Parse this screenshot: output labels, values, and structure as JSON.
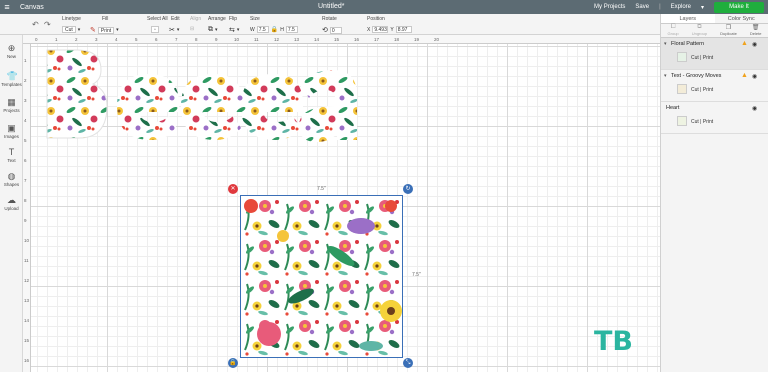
{
  "topbar": {
    "menu_icon": "hamburger-icon",
    "app_name": "Canvas",
    "doc_title": "Untitled*",
    "my_projects": "My Projects",
    "save": "Save",
    "explore": "Explore",
    "make_it": "Make It"
  },
  "toolbar": {
    "undo_icon": "undo-icon",
    "redo_icon": "redo-icon",
    "linetype_label": "Linetype",
    "linetype_value": "Cut",
    "fill_label": "Fill",
    "fill_value": "Print",
    "select_all_label": "Select All",
    "edit_label": "Edit",
    "align_label": "Align",
    "arrange_label": "Arrange",
    "flip_label": "Flip",
    "size_label": "Size",
    "w_label": "W",
    "w_value": "7.5",
    "h_label": "H",
    "h_value": "7.5",
    "rotate_label": "Rotate",
    "rotate_value": "0",
    "position_label": "Position",
    "x_label": "X",
    "x_value": "9.493",
    "y_label": "Y",
    "y_value": "8.97"
  },
  "sidebar": {
    "items": [
      {
        "label": "New",
        "icon": "plus-circle-icon"
      },
      {
        "label": "Templates",
        "icon": "shirt-icon"
      },
      {
        "label": "Projects",
        "icon": "grid-icon"
      },
      {
        "label": "Images",
        "icon": "image-icon"
      },
      {
        "label": "Text",
        "icon": "text-icon"
      },
      {
        "label": "Shapes",
        "icon": "shapes-icon"
      },
      {
        "label": "Upload",
        "icon": "cloud-upload-icon"
      }
    ]
  },
  "ruler": {
    "top": [
      "0",
      "1",
      "2",
      "3",
      "4",
      "5",
      "6",
      "7",
      "8",
      "9",
      "10",
      "11",
      "12",
      "13",
      "14",
      "15",
      "16",
      "17",
      "18",
      "19",
      "20"
    ],
    "left": [
      "1",
      "2",
      "3",
      "4",
      "5",
      "6",
      "7",
      "8",
      "9",
      "10",
      "11",
      "12",
      "13",
      "14",
      "15",
      "16",
      "17",
      "18",
      "19",
      "20"
    ]
  },
  "canvas": {
    "pattern_width_label": "7.5\"",
    "pattern_height_label": "7.5\"",
    "delete_icon": "close-icon",
    "rotate_icon": "rotate-icon",
    "lock_icon": "lock-icon",
    "resize_icon": "resize-icon"
  },
  "panel": {
    "tabs": [
      "Layers",
      "Color Sync"
    ],
    "tools": [
      "Group",
      "Ungroup",
      "Duplicate",
      "Delete"
    ],
    "layers": [
      {
        "name": "Floral Pattern",
        "op": "Cut | Print",
        "warning": true
      },
      {
        "name": "Text - Groovy Moves",
        "op": "Cut | Print",
        "warning": true
      },
      {
        "name": "Heart",
        "op": "Cut | Print",
        "warning": false
      }
    ]
  },
  "watermark": "TB",
  "colors": {
    "topbar": "#5c6b73",
    "make_it": "#1fae3d",
    "accent_blue": "#3a6fb7",
    "delete_red": "#e0393e"
  }
}
